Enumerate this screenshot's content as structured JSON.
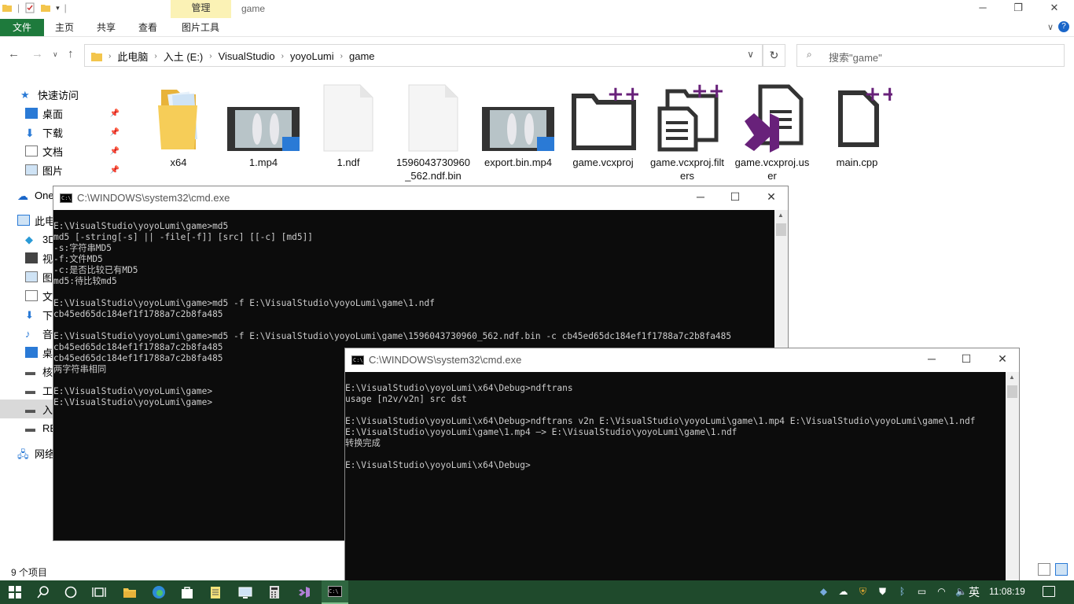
{
  "explorer": {
    "context_tab": "管理",
    "window_title": "game",
    "ribbon_tabs": [
      "文件",
      "主页",
      "共享",
      "查看",
      "图片工具"
    ],
    "address": [
      "此电脑",
      "入土 (E:)",
      "VisualStudio",
      "yoyoLumi",
      "game"
    ],
    "search_placeholder": "搜索\"game\"",
    "nav": {
      "quick_access": "快速访问",
      "quick_items": [
        "桌面",
        "下载",
        "文档",
        "图片"
      ],
      "onedrive": "One",
      "this_pc": "此电",
      "pc_items": [
        "3D",
        "视",
        "图",
        "文",
        "下",
        "音",
        "桌",
        "核",
        "工",
        "入",
        "RB"
      ],
      "network": "网络"
    },
    "files": [
      {
        "name": "x64",
        "kind": "folder"
      },
      {
        "name": "1.mp4",
        "kind": "video"
      },
      {
        "name": "1.ndf",
        "kind": "blank"
      },
      {
        "name": "1596043730960_562.ndf.bin",
        "kind": "blank"
      },
      {
        "name": "export.bin.mp4",
        "kind": "video"
      },
      {
        "name": "game.vcxproj",
        "kind": "vc-folder"
      },
      {
        "name": "game.vcxproj.filters",
        "kind": "vc-doc"
      },
      {
        "name": "game.vcxproj.user",
        "kind": "vs"
      },
      {
        "name": "main.cpp",
        "kind": "vc-file"
      }
    ],
    "status_count": "9 个项目"
  },
  "cmd1": {
    "title": "C:\\WINDOWS\\system32\\cmd.exe",
    "lines": [
      "E:\\VisualStudio\\yoyoLumi\\game>md5",
      "md5 [-string[-s] || -file[-f]] [src] [[-c] [md5]]",
      "-s:字符串MD5",
      "-f:文件MD5",
      "-c:是否比较已有MD5",
      "md5:待比较md5",
      "",
      "E:\\VisualStudio\\yoyoLumi\\game>md5 -f E:\\VisualStudio\\yoyoLumi\\game\\1.ndf",
      "cb45ed65dc184ef1f1788a7c2b8fa485",
      "",
      "E:\\VisualStudio\\yoyoLumi\\game>md5 -f E:\\VisualStudio\\yoyoLumi\\game\\1596043730960_562.ndf.bin -c cb45ed65dc184ef1f1788a7c2b8fa485",
      "cb45ed65dc184ef1f1788a7c2b8fa485",
      "cb45ed65dc184ef1f1788a7c2b8fa485",
      "两字符串相同",
      "",
      "E:\\VisualStudio\\yoyoLumi\\game>",
      "E:\\VisualStudio\\yoyoLumi\\game>"
    ]
  },
  "cmd2": {
    "title": "C:\\WINDOWS\\system32\\cmd.exe",
    "lines": [
      "E:\\VisualStudio\\yoyoLumi\\x64\\Debug>ndftrans",
      "usage [n2v/v2n] src dst",
      "",
      "E:\\VisualStudio\\yoyoLumi\\x64\\Debug>ndftrans v2n E:\\VisualStudio\\yoyoLumi\\game\\1.mp4 E:\\VisualStudio\\yoyoLumi\\game\\1.ndf",
      "E:\\VisualStudio\\yoyoLumi\\game\\1.mp4 —> E:\\VisualStudio\\yoyoLumi\\game\\1.ndf",
      "转换完成",
      "",
      "E:\\VisualStudio\\yoyoLumi\\x64\\Debug>"
    ]
  },
  "taskbar": {
    "ime": "英",
    "clock": "11:08:19"
  },
  "colors": {
    "ribbon_file_tab": "#1e7a3c",
    "manage_tab": "#fbf2b5",
    "taskbar": "#1f4a2c",
    "console_bg": "#0c0c0c",
    "console_fg": "#cccccc",
    "vs_purple": "#68217a"
  }
}
